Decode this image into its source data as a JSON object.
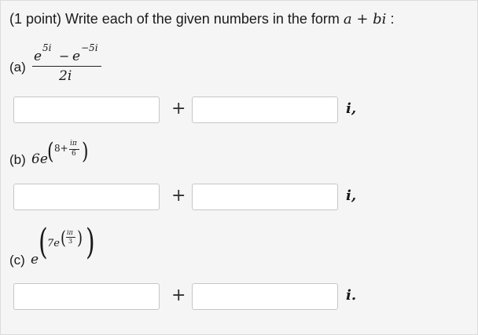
{
  "prompt": {
    "prefix": "(1 point) Write each of the given numbers in the form ",
    "form_a": "a",
    "form_plus": " + ",
    "form_b": "b",
    "form_i": "i",
    "suffix": " :"
  },
  "parts": [
    {
      "label": "(a)",
      "expr": {
        "num_base1": "e",
        "num_exp1": "5i",
        "minus": "−",
        "num_base2": "e",
        "num_exp2": "−5i",
        "den": "2i"
      },
      "real_value": "",
      "imag_value": "",
      "plus": "+",
      "i_suffix": "i,"
    },
    {
      "label": "(b)",
      "expr": {
        "coef": "6e",
        "lparen": "(",
        "eight": "8+",
        "fnum": "iπ",
        "fden": "6",
        "rparen": ")"
      },
      "real_value": "",
      "imag_value": "",
      "plus": "+",
      "i_suffix": "i,"
    },
    {
      "label": "(c)",
      "expr": {
        "base": "e",
        "lparen": "(",
        "inner": "7e",
        "ilparen": "(",
        "fnum": "iπ",
        "fden": "3",
        "irparen": ")",
        "rparen": ")"
      },
      "real_value": "",
      "imag_value": "",
      "plus": "+",
      "i_suffix": "i."
    }
  ]
}
